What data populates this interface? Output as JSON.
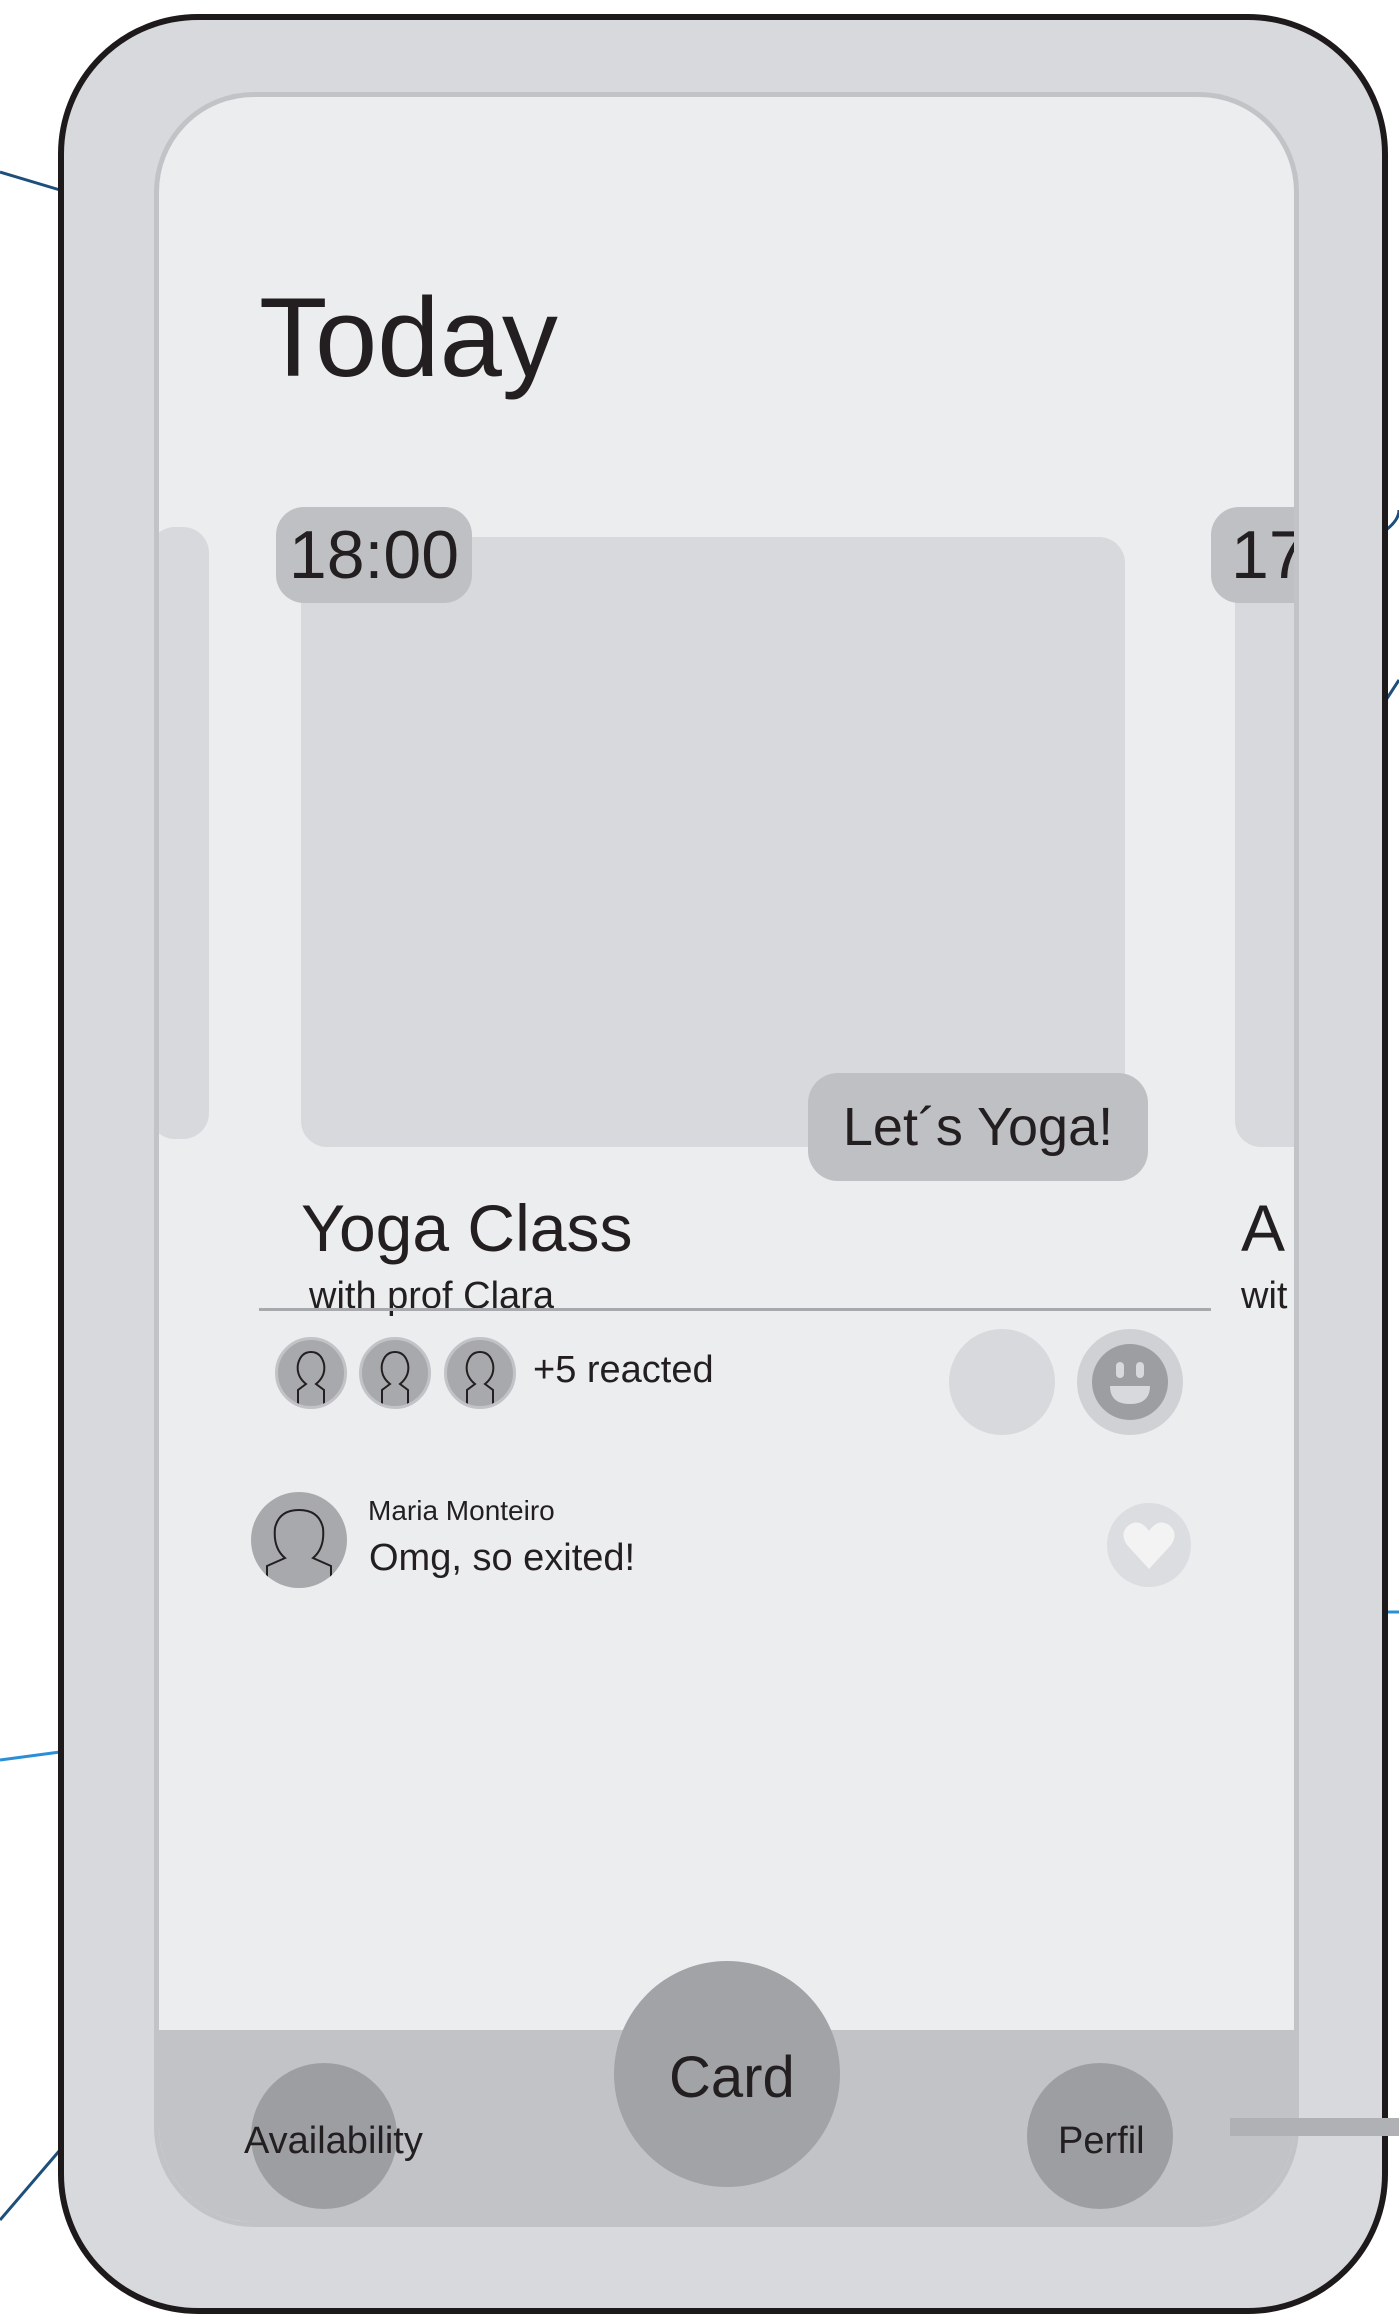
{
  "header": {
    "title": "Today"
  },
  "cards": [
    {
      "time": "18:00",
      "title": "Yoga Class",
      "subtitle": "with prof Clara",
      "cta_label": "Let´s Yoga!"
    },
    {
      "time": "17",
      "title": "A",
      "subtitle": "wit"
    }
  ],
  "reactions": {
    "summary": "+5 reacted",
    "buttons": [
      "blank-reaction",
      "smiley-icon"
    ]
  },
  "comment": {
    "author": "Maria Monteiro",
    "text": "Omg, so exited!"
  },
  "bottom_nav": {
    "left_label": "Availability",
    "center_label": "Card",
    "right_label": "Perfil"
  },
  "colors": {
    "phone_frame": "#d8d9dc",
    "screen_bg": "#ecedef",
    "placeholder": "#d8d9dc",
    "pill": "#bfc0c4",
    "nav_bar": "#c2c3c7",
    "nav_button": "#9d9ea2",
    "text": "#231f20"
  }
}
